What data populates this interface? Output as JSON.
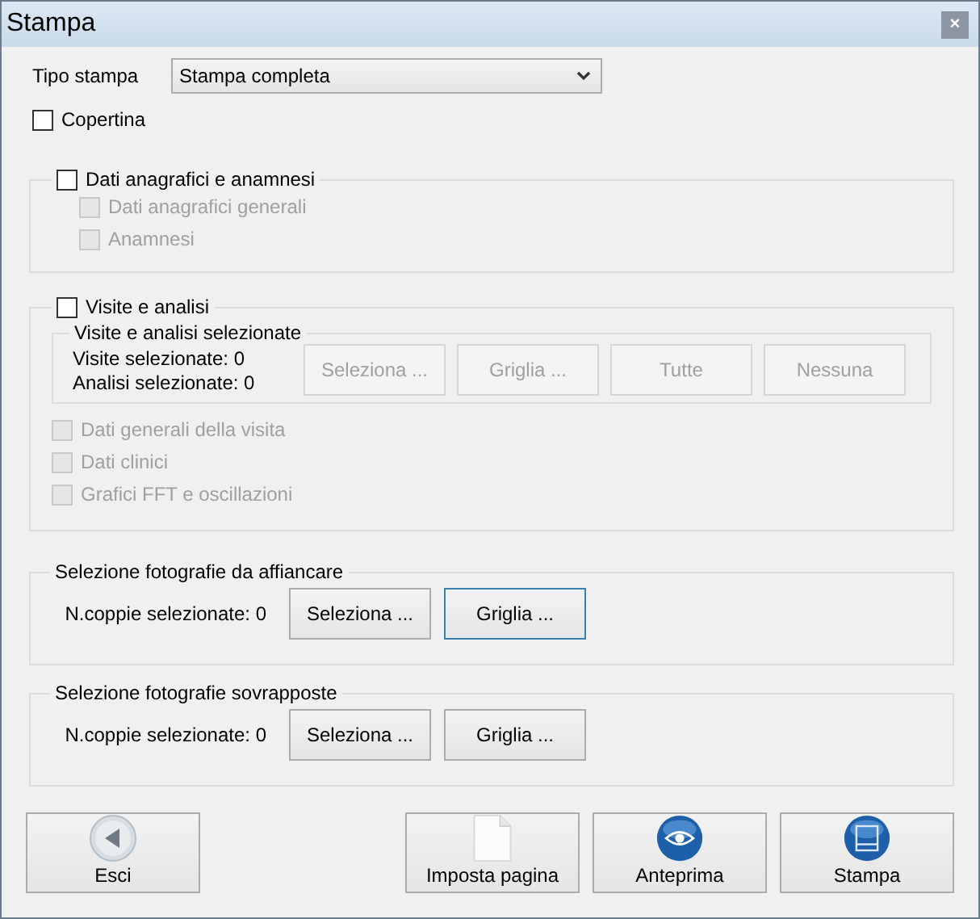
{
  "window": {
    "title": "Stampa",
    "close_glyph": "×"
  },
  "print_type": {
    "label": "Tipo stampa",
    "value": "Stampa completa"
  },
  "cover": {
    "label": "Copertina",
    "checked": false
  },
  "personal_data": {
    "label": "Dati anagrafici e anamnesi",
    "checked": false,
    "options": [
      {
        "label": "Dati anagrafici generali",
        "checked": false,
        "disabled": true
      },
      {
        "label": "Anamnesi",
        "checked": false,
        "disabled": true
      }
    ]
  },
  "visits": {
    "label": "Visite e analisi",
    "checked": false,
    "selection": {
      "title": "Visite e analisi selezionate",
      "counts": [
        "Visite selezionate: 0",
        "Analisi selezionate: 0"
      ],
      "buttons": [
        {
          "label": "Seleziona ...",
          "disabled": true,
          "focused": false
        },
        {
          "label": "Griglia ...",
          "disabled": true,
          "focused": false
        },
        {
          "label": "Tutte",
          "disabled": true,
          "focused": false
        },
        {
          "label": "Nessuna",
          "disabled": true,
          "focused": false
        }
      ]
    },
    "options": [
      {
        "label": "Dati generali della visita",
        "checked": false,
        "disabled": true
      },
      {
        "label": "Dati clinici",
        "checked": false,
        "disabled": true
      },
      {
        "label": "Grafici FFT e oscillazioni",
        "checked": false,
        "disabled": true
      }
    ]
  },
  "photo_groups": [
    {
      "title": "Selezione fotografie da affiancare",
      "count": "N.coppie selezionate: 0",
      "buttons": [
        {
          "label": "Seleziona ...",
          "disabled": false,
          "focused": false
        },
        {
          "label": "Griglia ...",
          "disabled": false,
          "focused": true
        }
      ]
    },
    {
      "title": "Selezione fotografie sovrapposte",
      "count": "N.coppie selezionate: 0",
      "buttons": [
        {
          "label": "Seleziona ...",
          "disabled": false,
          "focused": false
        },
        {
          "label": "Griglia ...",
          "disabled": false,
          "focused": false
        }
      ]
    }
  ],
  "footer_buttons": [
    {
      "label": "Esci",
      "kind": "back"
    },
    {
      "label": "Imposta pagina",
      "kind": "page"
    },
    {
      "label": "Anteprima",
      "kind": "preview"
    },
    {
      "label": "Stampa",
      "kind": "print"
    }
  ]
}
